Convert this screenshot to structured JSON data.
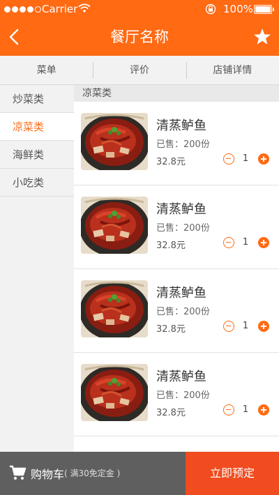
{
  "status_bar": {
    "carrier": "Carrier",
    "battery": "100%"
  },
  "header": {
    "title": "餐厅名称"
  },
  "tabs": [
    {
      "label": "菜单"
    },
    {
      "label": "评价"
    },
    {
      "label": "店铺详情"
    }
  ],
  "sidebar": {
    "categories": [
      {
        "label": "炒菜类"
      },
      {
        "label": "凉菜类"
      },
      {
        "label": "海鲜类"
      },
      {
        "label": "小吃类"
      }
    ],
    "active_index": 1
  },
  "section": {
    "title": "凉菜类"
  },
  "menu_items": [
    {
      "name": "清蒸鲈鱼",
      "sold": "已售：200份",
      "price": "32.8元",
      "quantity": "1"
    },
    {
      "name": "清蒸鲈鱼",
      "sold": "已售：200份",
      "price": "32.8元",
      "quantity": "1"
    },
    {
      "name": "清蒸鲈鱼",
      "sold": "已售：200份",
      "price": "32.8元",
      "quantity": "1"
    },
    {
      "name": "清蒸鲈鱼",
      "sold": "已售：200份",
      "price": "32.8元",
      "quantity": "1"
    }
  ],
  "footer": {
    "cart_label": "购物车",
    "cart_note": "( 满30免定金 )",
    "order_label": "立即预定"
  },
  "colors": {
    "accent": "#ff6a13",
    "order_button": "#f04c1f",
    "cart_bar": "#5f5f5f"
  },
  "icons": {
    "back": "chevron-left-icon",
    "favorite": "star-icon",
    "cart": "cart-icon",
    "minus": "minus-circle-icon",
    "plus": "plus-circle-icon"
  }
}
